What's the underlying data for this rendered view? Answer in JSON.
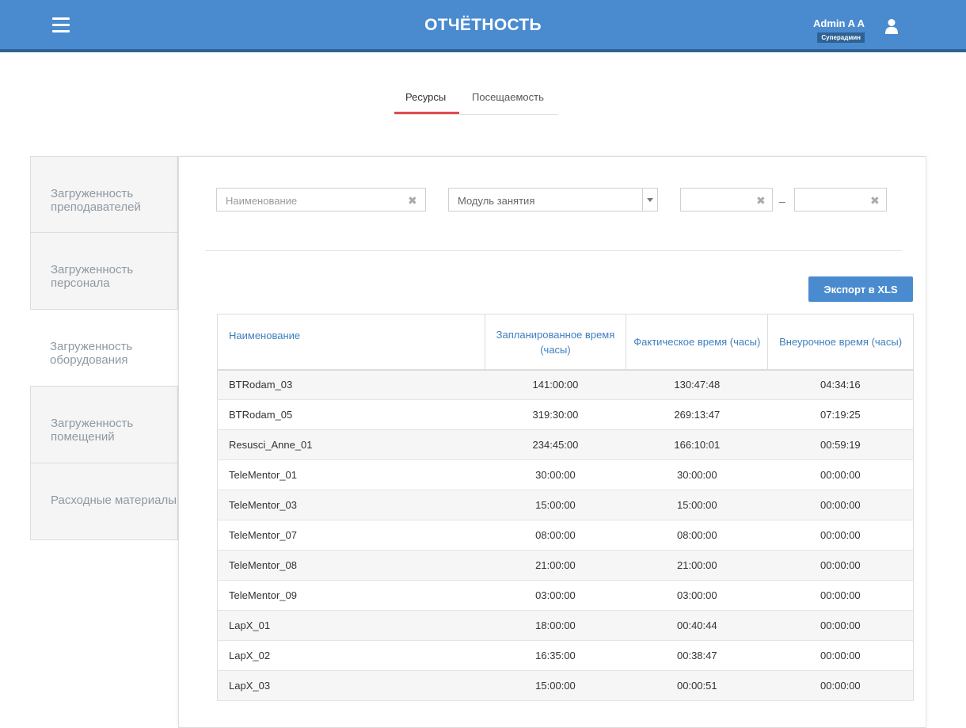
{
  "header": {
    "title": "ОТЧЁТНОСТЬ",
    "user_name": "Admin A A",
    "user_role": "Суперадмин",
    "menu_icon": "hamburger-menu-icon",
    "user_icon": "user-icon",
    "bg_color": "#4a8bcf"
  },
  "tabs": [
    {
      "label": "Ресурсы",
      "active": true
    },
    {
      "label": "Посещаемость",
      "active": false
    }
  ],
  "sidebar": {
    "items": [
      {
        "label": "Загруженность преподавателей",
        "active": false
      },
      {
        "label": "Загруженность персонала",
        "active": false
      },
      {
        "label": "Загруженность оборудования",
        "active": true
      },
      {
        "label": "Загруженность помещений",
        "active": false
      },
      {
        "label": "Расходные материалы",
        "active": false
      }
    ]
  },
  "filters": {
    "name_placeholder": "Наименование",
    "module_value": "Модуль занятия",
    "date_from": "",
    "date_to": "",
    "date_separator": "–"
  },
  "export_button": "Экспорт в XLS",
  "table": {
    "headers": [
      "Наименование",
      "Запланированное время (часы)",
      "Фактическое время (часы)",
      "Внеурочное время (часы)"
    ],
    "rows": [
      [
        "BTRodam_03",
        "141:00:00",
        "130:47:48",
        "04:34:16"
      ],
      [
        "BTRodam_05",
        "319:30:00",
        "269:13:47",
        "07:19:25"
      ],
      [
        "Resusci_Anne_01",
        "234:45:00",
        "166:10:01",
        "00:59:19"
      ],
      [
        "TeleMentor_01",
        "30:00:00",
        "30:00:00",
        "00:00:00"
      ],
      [
        "TeleMentor_03",
        "15:00:00",
        "15:00:00",
        "00:00:00"
      ],
      [
        "TeleMentor_07",
        "08:00:00",
        "08:00:00",
        "00:00:00"
      ],
      [
        "TeleMentor_08",
        "21:00:00",
        "21:00:00",
        "00:00:00"
      ],
      [
        "TeleMentor_09",
        "03:00:00",
        "03:00:00",
        "00:00:00"
      ],
      [
        "LapX_01",
        "18:00:00",
        "00:40:44",
        "00:00:00"
      ],
      [
        "LapX_02",
        "16:35:00",
        "00:38:47",
        "00:00:00"
      ],
      [
        "LapX_03",
        "15:00:00",
        "00:00:51",
        "00:00:00"
      ]
    ]
  }
}
